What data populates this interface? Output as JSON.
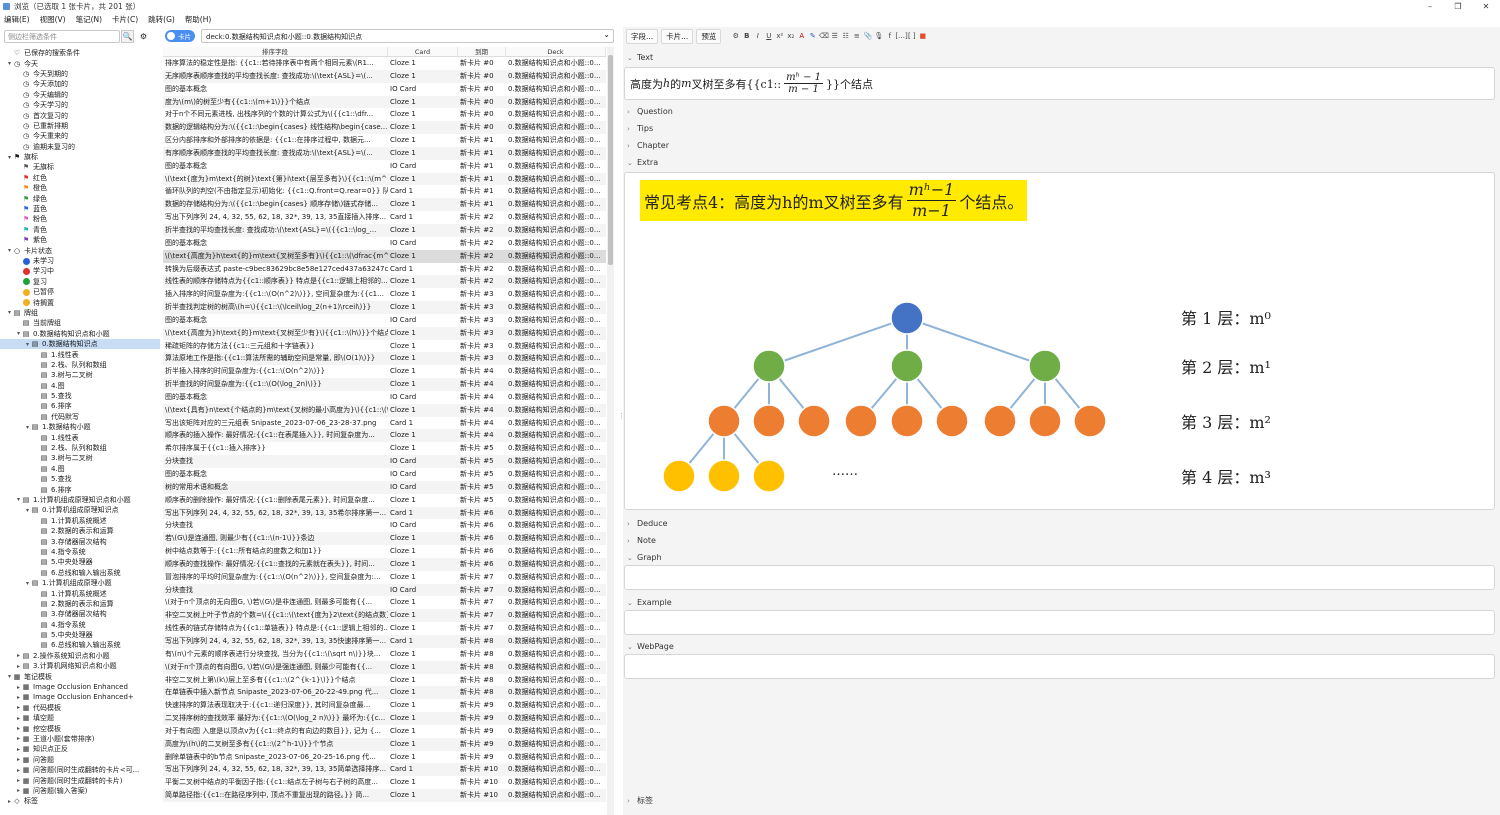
{
  "window": {
    "title": "浏览（已选取 1 张卡片，共 201 张）",
    "min": "–",
    "max": "❐",
    "close": "✕"
  },
  "menu": [
    "编辑(E)",
    "视图(V)",
    "笔记(N)",
    "卡片(C)",
    "跳转(G)",
    "帮助(H)"
  ],
  "sidebar": {
    "search_placeholder": "侧边栏筛选条件",
    "search_icon": "🔍",
    "options_icon": "⚙",
    "tree": [
      {
        "t": "已保存的搜索条件",
        "lv": 0,
        "ar": "",
        "ic": "♡"
      },
      {
        "t": "今天",
        "lv": 0,
        "ar": "▾",
        "ic": "◷"
      },
      {
        "t": "今天到期的",
        "lv": 1,
        "ar": "",
        "ic": "◷"
      },
      {
        "t": "今天添加的",
        "lv": 1,
        "ar": "",
        "ic": "◷"
      },
      {
        "t": "今天编辑的",
        "lv": 1,
        "ar": "",
        "ic": "◷"
      },
      {
        "t": "今天学习的",
        "lv": 1,
        "ar": "",
        "ic": "◷"
      },
      {
        "t": "首次复习的",
        "lv": 1,
        "ar": "",
        "ic": "◷"
      },
      {
        "t": "已重新排期",
        "lv": 1,
        "ar": "",
        "ic": "◷"
      },
      {
        "t": "今天重来的",
        "lv": 1,
        "ar": "",
        "ic": "◷"
      },
      {
        "t": "逾期未复习的",
        "lv": 1,
        "ar": "",
        "ic": "◷"
      },
      {
        "t": "旗标",
        "lv": 0,
        "ar": "▾",
        "ic": "⚑"
      },
      {
        "t": "无旗标",
        "lv": 1,
        "ar": "",
        "ic": "⚑",
        "c": "#555"
      },
      {
        "t": "红色",
        "lv": 1,
        "ar": "",
        "ic": "⚑",
        "c": "#e03030"
      },
      {
        "t": "橙色",
        "lv": 1,
        "ar": "",
        "ic": "⚑",
        "c": "#f08a20"
      },
      {
        "t": "绿色",
        "lv": 1,
        "ar": "",
        "ic": "⚑",
        "c": "#2aa040"
      },
      {
        "t": "蓝色",
        "lv": 1,
        "ar": "",
        "ic": "⚑",
        "c": "#3060e0"
      },
      {
        "t": "粉色",
        "lv": 1,
        "ar": "",
        "ic": "⚑",
        "c": "#e060c0"
      },
      {
        "t": "青色",
        "lv": 1,
        "ar": "",
        "ic": "⚑",
        "c": "#20b0b0"
      },
      {
        "t": "紫色",
        "lv": 1,
        "ar": "",
        "ic": "⚑",
        "c": "#8040c0"
      },
      {
        "t": "卡片状态",
        "lv": 0,
        "ar": "▾",
        "ic": "○"
      },
      {
        "t": "未学习",
        "lv": 1,
        "ar": "",
        "dot": "#2860d8"
      },
      {
        "t": "学习中",
        "lv": 1,
        "ar": "",
        "dot": "#e03030"
      },
      {
        "t": "复习",
        "lv": 1,
        "ar": "",
        "dot": "#20a040"
      },
      {
        "t": "已暂停",
        "lv": 1,
        "ar": "",
        "dot": "#f0b020"
      },
      {
        "t": "待搁置",
        "lv": 1,
        "ar": "",
        "dot": "#f0b020"
      },
      {
        "t": "牌组",
        "lv": 0,
        "ar": "▾",
        "ic": "▤"
      },
      {
        "t": "当前牌组",
        "lv": 1,
        "ar": "",
        "ic": "▤"
      },
      {
        "t": "0.数据结构知识点和小题",
        "lv": 1,
        "ar": "▾",
        "ic": "▤"
      },
      {
        "t": "0.数据结构知识点",
        "lv": 2,
        "ar": "▾",
        "ic": "▤",
        "sel": true
      },
      {
        "t": "1.线性表",
        "lv": 3,
        "ar": "",
        "ic": "▤"
      },
      {
        "t": "2.栈、队列和数组",
        "lv": 3,
        "ar": "",
        "ic": "▤"
      },
      {
        "t": "3.树与二叉树",
        "lv": 3,
        "ar": "",
        "ic": "▤"
      },
      {
        "t": "4.图",
        "lv": 3,
        "ar": "",
        "ic": "▤"
      },
      {
        "t": "5.查找",
        "lv": 3,
        "ar": "",
        "ic": "▤"
      },
      {
        "t": "6.排序",
        "lv": 3,
        "ar": "",
        "ic": "▤"
      },
      {
        "t": "代码默写",
        "lv": 3,
        "ar": "",
        "ic": "▤"
      },
      {
        "t": "1.数据结构小题",
        "lv": 2,
        "ar": "▾",
        "ic": "▤"
      },
      {
        "t": "1.线性表",
        "lv": 3,
        "ar": "",
        "ic": "▤"
      },
      {
        "t": "2.栈、队列和数组",
        "lv": 3,
        "ar": "",
        "ic": "▤"
      },
      {
        "t": "3.树与二叉树",
        "lv": 3,
        "ar": "",
        "ic": "▤"
      },
      {
        "t": "4.图",
        "lv": 3,
        "ar": "",
        "ic": "▤"
      },
      {
        "t": "5.查找",
        "lv": 3,
        "ar": "",
        "ic": "▤"
      },
      {
        "t": "6.排序",
        "lv": 3,
        "ar": "",
        "ic": "▤"
      },
      {
        "t": "1.计算机组成原理知识点和小题",
        "lv": 1,
        "ar": "▾",
        "ic": "▤"
      },
      {
        "t": "0.计算机组成原理知识点",
        "lv": 2,
        "ar": "▾",
        "ic": "▤"
      },
      {
        "t": "1.计算机系统概述",
        "lv": 3,
        "ar": "",
        "ic": "▤"
      },
      {
        "t": "2.数据的表示和运算",
        "lv": 3,
        "ar": "",
        "ic": "▤"
      },
      {
        "t": "3.存储器层次结构",
        "lv": 3,
        "ar": "",
        "ic": "▤"
      },
      {
        "t": "4.指令系统",
        "lv": 3,
        "ar": "",
        "ic": "▤"
      },
      {
        "t": "5.中央处理器",
        "lv": 3,
        "ar": "",
        "ic": "▤"
      },
      {
        "t": "6.总线和输入输出系统",
        "lv": 3,
        "ar": "",
        "ic": "▤"
      },
      {
        "t": "1.计算机组成原理小题",
        "lv": 2,
        "ar": "▾",
        "ic": "▤"
      },
      {
        "t": "1.计算机系统概述",
        "lv": 3,
        "ar": "",
        "ic": "▤"
      },
      {
        "t": "2.数据的表示和运算",
        "lv": 3,
        "ar": "",
        "ic": "▤"
      },
      {
        "t": "3.存储器层次结构",
        "lv": 3,
        "ar": "",
        "ic": "▤"
      },
      {
        "t": "4.指令系统",
        "lv": 3,
        "ar": "",
        "ic": "▤"
      },
      {
        "t": "5.中央处理器",
        "lv": 3,
        "ar": "",
        "ic": "▤"
      },
      {
        "t": "6.总线和输入输出系统",
        "lv": 3,
        "ar": "",
        "ic": "▤"
      },
      {
        "t": "2.操作系统知识点和小题",
        "lv": 1,
        "ar": "▸",
        "ic": "▤"
      },
      {
        "t": "3.计算机网络知识点和小题",
        "lv": 1,
        "ar": "▸",
        "ic": "▤"
      },
      {
        "t": "笔记模板",
        "lv": 0,
        "ar": "▾",
        "ic": "▦"
      },
      {
        "t": "Image Occlusion Enhanced",
        "lv": 1,
        "ar": "▸",
        "ic": "▦"
      },
      {
        "t": "Image Occlusion Enhanced+",
        "lv": 1,
        "ar": "▸",
        "ic": "▦"
      },
      {
        "t": "代码模板",
        "lv": 1,
        "ar": "▸",
        "ic": "▦"
      },
      {
        "t": "填空题",
        "lv": 1,
        "ar": "▸",
        "ic": "▦"
      },
      {
        "t": "挖空模板",
        "lv": 1,
        "ar": "▸",
        "ic": "▦"
      },
      {
        "t": "王道小题(套带排序)",
        "lv": 1,
        "ar": "▸",
        "ic": "▦"
      },
      {
        "t": "知识点正反",
        "lv": 1,
        "ar": "▸",
        "ic": "▦"
      },
      {
        "t": "问答题",
        "lv": 1,
        "ar": "▸",
        "ic": "▦"
      },
      {
        "t": "问答题(同时生成翻转的卡片<可...",
        "lv": 1,
        "ar": "▸",
        "ic": "▦"
      },
      {
        "t": "问答题(同时生成翻转的卡片)",
        "lv": 1,
        "ar": "▸",
        "ic": "▦"
      },
      {
        "t": "问答题(输入答案)",
        "lv": 1,
        "ar": "▸",
        "ic": "▦"
      },
      {
        "t": "标签",
        "lv": 0,
        "ar": "▸",
        "ic": "◇"
      }
    ]
  },
  "browser": {
    "toggle_label": "卡片",
    "search_value": "deck:0.数据结构知识点和小题::0.数据结构知识点",
    "columns": [
      "排序字段",
      "Card",
      "到期",
      "Deck"
    ],
    "rows": [
      [
        "排序算法的稳定性是指: {{c1::若待排序表中有两个相同元素\\(R1...",
        "Cloze 1",
        "新卡片 #0",
        "0.数据结构知识点和小题::0..."
      ],
      [
        "无序顺序表顺序查找的平均查找长度: 查找成功:\\(\\text{ASL}=\\(...",
        "Cloze 1",
        "新卡片 #0",
        "0.数据结构知识点和小题::0..."
      ],
      [
        "图的基本概念",
        "IO Card",
        "新卡片 #0",
        "0.数据结构知识点和小题::0..."
      ],
      [
        "度为\\(m\\)的树至少有{{c1::\\(m+1\\)}}个结点",
        "Cloze 1",
        "新卡片 #0",
        "0.数据结构知识点和小题::0..."
      ],
      [
        "对于n个不同元素进栈, 出栈序列的个数的计算公式为\\({{c1::\\dfr...",
        "Cloze 1",
        "新卡片 #0",
        "0.数据结构知识点和小题::0..."
      ],
      [
        "数据的逻辑结构分为:\\({{c1::\\begin{cases} 线性结构\\begin{case...",
        "Cloze 1",
        "新卡片 #0",
        "0.数据结构知识点和小题::0..."
      ],
      [
        "区分内部排序和外部排序的依据是: {{c1::在排序过程中, 数据元...",
        "Cloze 1",
        "新卡片 #1",
        "0.数据结构知识点和小题::0..."
      ],
      [
        "有序顺序表顺序查找的平均查找长度: 查找成功:\\(\\text{ASL}=\\(...",
        "Cloze 1",
        "新卡片 #1",
        "0.数据结构知识点和小题::0..."
      ],
      [
        "图的基本概念",
        "IO Card",
        "新卡片 #1",
        "0.数据结构知识点和小题::0..."
      ],
      [
        "\\(\\text{度为}m\\text{的树}\\text{第}i\\text{层至多有}\\){{c1::\\(m^{i-1}\\)}}个...",
        "Cloze 1",
        "新卡片 #1",
        "0.数据结构知识点和小题::0..."
      ],
      [
        "循环队列的判空(不由指定显示)初始化: {{c1::Q.front=Q.rear=0}} 队首...",
        "Card 1",
        "新卡片 #1",
        "0.数据结构知识点和小题::0..."
      ],
      [
        "数据的存储结构分为:\\({{c1::\\begin{cases} 顺序存储\\)链式存储...",
        "Cloze 1",
        "新卡片 #1",
        "0.数据结构知识点和小题::0..."
      ],
      [
        "写出下列序列 24, 4, 32, 55, 62, 18, 32*, 39, 13, 35直接插入排序...",
        "Card 1",
        "新卡片 #2",
        "0.数据结构知识点和小题::0..."
      ],
      [
        "折半查找的平均查找长度: 查找成功:\\(\\text{ASL}=\\({{c1::\\log_...",
        "Cloze 1",
        "新卡片 #2",
        "0.数据结构知识点和小题::0..."
      ],
      [
        "图的基本概念",
        "IO Card",
        "新卡片 #2",
        "0.数据结构知识点和小题::0..."
      ],
      [
        "\\(\\text{高度为}h\\text{的}m\\text{叉树至多有}\\){{c1::\\(\\dfrac{m^h-1...",
        "Cloze 1",
        "新卡片 #2",
        "0.数据结构知识点和小题::0..."
      ],
      [
        "转换为后缀表达式 paste-c9bec83629bc8e58e127ced437a63247c96...",
        "Card 1",
        "新卡片 #2",
        "0.数据结构知识点和小题::0..."
      ],
      [
        "线性表的顺序存储特点为{{c1::顺序表}} 特点是{{c1::逻辑上相邻的...",
        "Cloze 1",
        "新卡片 #2",
        "0.数据结构知识点和小题::0..."
      ],
      [
        "插入排序的时间复杂度为:{{c1::\\(O(n^2)\\)}}, 空间复杂度为:{{c1...",
        "Cloze 1",
        "新卡片 #3",
        "0.数据结构知识点和小题::0..."
      ],
      [
        "折半查找判定树的树高\\(h=\\){{c1::\\(\\lceil\\log_2(n+1)\\rceil\\)}}",
        "Cloze 1",
        "新卡片 #3",
        "0.数据结构知识点和小题::0..."
      ],
      [
        "图的基本概念",
        "IO Card",
        "新卡片 #3",
        "0.数据结构知识点和小题::0..."
      ],
      [
        "\\(\\text{高度为}h\\text{的}m\\text{叉树至少有}\\){{c1::\\(h\\)}}个结点 \\(\\...",
        "Cloze 1",
        "新卡片 #3",
        "0.数据结构知识点和小题::0..."
      ],
      [
        "稀疏矩阵的存储方法{{c1::三元组和十字链表}}",
        "Cloze 1",
        "新卡片 #3",
        "0.数据结构知识点和小题::0..."
      ],
      [
        "算法原地工作是指:{{c1::算法所需的辅助空间是常量, 即\\(O(1)\\)}}",
        "Cloze 1",
        "新卡片 #3",
        "0.数据结构知识点和小题::0..."
      ],
      [
        "折半插入排序的时间复杂度为:{{c1::\\(O(n^2)\\)}}",
        "Cloze 1",
        "新卡片 #4",
        "0.数据结构知识点和小题::0..."
      ],
      [
        "折半查找的时间复杂度为:{{c1::\\(O(\\log_2n)\\)}}",
        "Cloze 1",
        "新卡片 #4",
        "0.数据结构知识点和小题::0..."
      ],
      [
        "图的基本概念",
        "IO Card",
        "新卡片 #4",
        "0.数据结构知识点和小题::0..."
      ],
      [
        "\\(\\text{具有}n\\text{个结点的}m\\text{叉树的最小高度为}\\){{c1::\\(\\...",
        "Cloze 1",
        "新卡片 #4",
        "0.数据结构知识点和小题::0..."
      ],
      [
        "写出该矩阵对应的三元组表 Snipaste_2023-07-06_23-28-37.png",
        "Card 1",
        "新卡片 #4",
        "0.数据结构知识点和小题::0..."
      ],
      [
        "顺序表的插入操作: 最好情况:{{c1::在表尾插入}}, 时间复杂度为...",
        "Cloze 1",
        "新卡片 #4",
        "0.数据结构知识点和小题::0..."
      ],
      [
        "希尔排序属于{{c1::插入排序}}",
        "Cloze 1",
        "新卡片 #5",
        "0.数据结构知识点和小题::0..."
      ],
      [
        "分块查找",
        "IO Card",
        "新卡片 #5",
        "0.数据结构知识点和小题::0..."
      ],
      [
        "图的基本概念",
        "IO Card",
        "新卡片 #5",
        "0.数据结构知识点和小题::0..."
      ],
      [
        "树的常用术语和概念",
        "IO Card",
        "新卡片 #5",
        "0.数据结构知识点和小题::0..."
      ],
      [
        "顺序表的删除操作: 最好情况:{{c1::删除表尾元素}}, 时间复杂度...",
        "Cloze 1",
        "新卡片 #5",
        "0.数据结构知识点和小题::0..."
      ],
      [
        "写出下列序列 24, 4, 32, 55, 62, 18, 32*, 39, 13, 35希尔排序第一...",
        "Card 1",
        "新卡片 #6",
        "0.数据结构知识点和小题::0..."
      ],
      [
        "分块查找",
        "IO Card",
        "新卡片 #6",
        "0.数据结构知识点和小题::0..."
      ],
      [
        "若\\(G\\)是连通图, 则最少有{{c1::\\(n-1\\)}}条边",
        "Cloze 1",
        "新卡片 #6",
        "0.数据结构知识点和小题::0..."
      ],
      [
        "树中结点数等于:{{c1::所有结点的度数之和加1}}",
        "Cloze 1",
        "新卡片 #6",
        "0.数据结构知识点和小题::0..."
      ],
      [
        "顺序表的查找操作: 最好情况:{{c1::查找的元素就在表头}}, 时间...",
        "Cloze 1",
        "新卡片 #6",
        "0.数据结构知识点和小题::0..."
      ],
      [
        "冒泡排序的平均时间复杂度为:{{c1::\\(O(n^2)\\)}}, 空间复杂度为:...",
        "Cloze 1",
        "新卡片 #7",
        "0.数据结构知识点和小题::0..."
      ],
      [
        "分块查找",
        "IO Card",
        "新卡片 #7",
        "0.数据结构知识点和小题::0..."
      ],
      [
        "\\(对于n个顶点的无向图G, \\)若\\(G\\)是非连通图, 则最多可能有{{...",
        "Cloze 1",
        "新卡片 #7",
        "0.数据结构知识点和小题::0..."
      ],
      [
        "非空二叉树上叶子节点的个数=\\({{c1::\\(\\text{度为}2\\text{的结点数}...",
        "Cloze 1",
        "新卡片 #7",
        "0.数据结构知识点和小题::0..."
      ],
      [
        "线性表的链式存储特点为{{c1::单链表}} 特点是:{{c1::逻辑上相邻的...",
        "Cloze 1",
        "新卡片 #7",
        "0.数据结构知识点和小题::0..."
      ],
      [
        "写出下列序列 24, 4, 32, 55, 62, 18, 32*, 39, 13, 35快速排序第一...",
        "Card 1",
        "新卡片 #8",
        "0.数据结构知识点和小题::0..."
      ],
      [
        "有\\(n\\)个元素的顺序表进行分块查找, 当分为{{c1::\\(\\sqrt n\\)}}块...",
        "Cloze 1",
        "新卡片 #8",
        "0.数据结构知识点和小题::0..."
      ],
      [
        "\\(对于n个顶点的有向图G, \\)若\\(G\\)是强连通图, 则最少可能有{{...",
        "Cloze 1",
        "新卡片 #8",
        "0.数据结构知识点和小题::0..."
      ],
      [
        "非空二叉树上第\\(k\\)层上至多有{{c1::\\(2^{k-1}\\)}}个结点",
        "Cloze 1",
        "新卡片 #8",
        "0.数据结构知识点和小题::0..."
      ],
      [
        "在单链表中插入新节点 Snipaste_2023-07-06_20-22-49.png 代...",
        "Cloze 1",
        "新卡片 #8",
        "0.数据结构知识点和小题::0..."
      ],
      [
        "快速排序的算法表现取决于:{{c1::递归深度}}, 其时间复杂度最...",
        "Cloze 1",
        "新卡片 #9",
        "0.数据结构知识点和小题::0..."
      ],
      [
        "二叉排序树的查找效率 最好为:{{c1::\\(O(\\log_2 n)\\)}} 最坏为:{{c...",
        "Cloze 1",
        "新卡片 #9",
        "0.数据结构知识点和小题::0..."
      ],
      [
        "对于有向图 入度是以顶点v为{{c1::终点的有向边的数目}}, 记为 {...",
        "Cloze 1",
        "新卡片 #9",
        "0.数据结构知识点和小题::0..."
      ],
      [
        "高度为\\(h\\)的二叉树至多有{{c1::\\(2^h-1\\)}}个节点",
        "Cloze 1",
        "新卡片 #9",
        "0.数据结构知识点和小题::0..."
      ],
      [
        "删除单链表中的b节点 Snipaste_2023-07-06_20-25-16.png 代...",
        "Cloze 1",
        "新卡片 #9",
        "0.数据结构知识点和小题::0..."
      ],
      [
        "写出下列序列 24, 4, 32, 55, 62, 18, 32*, 39, 13, 35简单选择排序...",
        "Card 1",
        "新卡片 #10",
        "0.数据结构知识点和小题::0..."
      ],
      [
        "平衡二叉树中结点的平衡因子指:{{c1::结点左子树与右子树的高度...",
        "Cloze 1",
        "新卡片 #10",
        "0.数据结构知识点和小题::0..."
      ],
      [
        "简单路径指:{{c1::在路径序列中, 顶点不重复出现的路径。}} 简...",
        "Cloze 1",
        "新卡片 #10",
        "0.数据结构知识点和小题::0..."
      ]
    ],
    "selected_row": 15
  },
  "editor": {
    "toolbar": {
      "fields_btn": "字段...",
      "cards_btn": "卡片...",
      "preview_btn": "预览",
      "icons": [
        "gear-icon",
        "bold-icon",
        "italic-icon",
        "underline-icon",
        "superscript-icon",
        "subscript-icon",
        "text-color-icon",
        "highlight-icon",
        "eraser-icon",
        "bullet-list-icon",
        "numbered-list-icon",
        "indent-icon",
        "attach-icon",
        "record-icon",
        "formula-icon",
        "cloze-icon",
        "bracket-icon",
        "stop-icon"
      ],
      "glyphs": [
        "⚙",
        "B",
        "I",
        "U",
        "x²",
        "x₂",
        "A",
        "✎",
        "⌫",
        "☰",
        "☷",
        "≡",
        "📎",
        "🎙",
        "f",
        "[…]",
        "[ ]",
        "■"
      ]
    },
    "fields": {
      "text": "Text",
      "question": "Question",
      "tips": "Tips",
      "chapter": "Chapter",
      "extra": "Extra",
      "deduce": "Deduce",
      "note": "Note",
      "graph": "Graph",
      "example": "Example",
      "webpage": "WebPage",
      "tags": "标签"
    },
    "text_value": {
      "prefix": "高度为",
      "h": "h",
      "mid": "的",
      "m": "m",
      "suffix_a": "叉树至多有{{c1::",
      "num": "mʰ − 1",
      "den": "m − 1",
      "suffix_b": "}}个结点"
    },
    "extra": {
      "headline_pre": "常见考点4：高度为h的m叉树至多有",
      "num": "mʰ−1",
      "den": "m−1",
      "headline_post": "个结点。",
      "levels": [
        "第 1 层：m⁰",
        "第 2 层：m¹",
        "第 3 层：m²",
        "第 4 层：m³"
      ],
      "ellipsis": "……",
      "colors": {
        "root": "#4472c4",
        "l2": "#70ad47",
        "l3": "#ed7d31",
        "l4": "#ffc000",
        "edge": "#8fb4d8"
      }
    }
  }
}
